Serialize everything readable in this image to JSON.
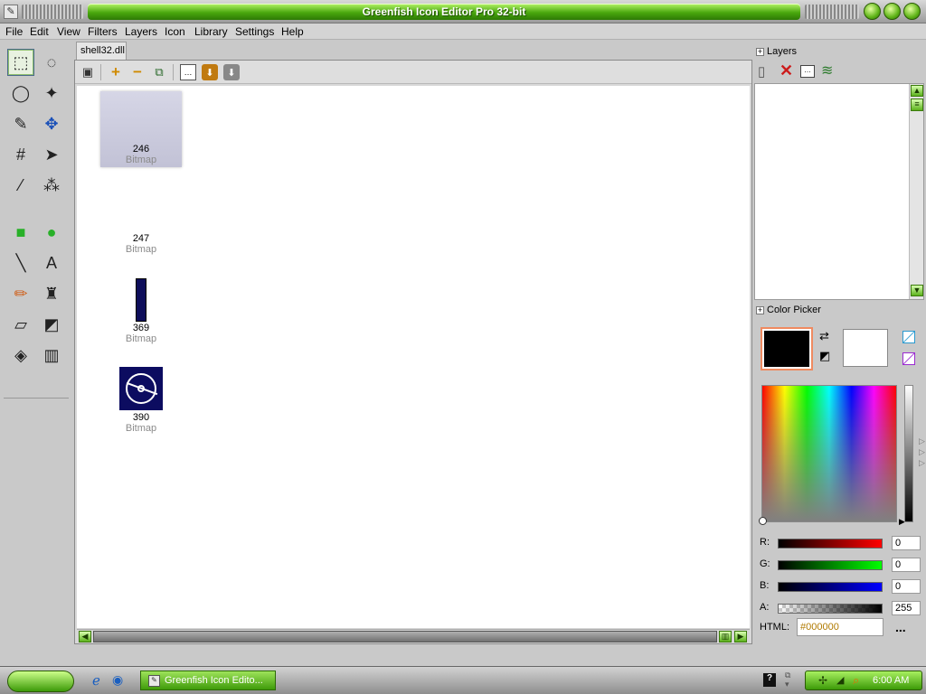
{
  "window": {
    "title": "Greenfish Icon Editor Pro 32-bit",
    "app_icon": "app-icon"
  },
  "menu": [
    "File",
    "Edit",
    "View",
    "Filters",
    "Layers",
    "Icon",
    "Library",
    "Settings",
    "Help"
  ],
  "tools": [
    {
      "name": "rect-select-icon",
      "glyph": "⬚",
      "active": true
    },
    {
      "name": "ellipse-select-icon",
      "glyph": "◌",
      "active": false
    },
    {
      "name": "lasso-icon",
      "glyph": "◯",
      "active": false
    },
    {
      "name": "magic-wand-icon",
      "glyph": "✦",
      "active": false
    },
    {
      "name": "pen-select-icon",
      "glyph": "✎",
      "active": false
    },
    {
      "name": "move-icon",
      "glyph": "✥",
      "active": false
    },
    {
      "name": "crop-icon",
      "glyph": "#",
      "active": false
    },
    {
      "name": "pointer-icon",
      "glyph": "➤",
      "active": false
    },
    {
      "name": "eyedropper-icon",
      "glyph": "⁄",
      "active": false
    },
    {
      "name": "spray-icon",
      "glyph": "⁂",
      "active": false
    },
    {
      "name": "rectangle-icon",
      "glyph": "■",
      "active": false
    },
    {
      "name": "ellipse-icon",
      "glyph": "●",
      "active": false
    },
    {
      "name": "line-icon",
      "glyph": "╲",
      "active": false
    },
    {
      "name": "text-icon",
      "glyph": "A",
      "active": false
    },
    {
      "name": "pencil-icon",
      "glyph": "✏",
      "active": false
    },
    {
      "name": "brush-icon",
      "glyph": "♜",
      "active": false
    },
    {
      "name": "eraser-icon",
      "glyph": "▱",
      "active": false
    },
    {
      "name": "color-swap-icon",
      "glyph": "◩",
      "active": false
    },
    {
      "name": "fill-icon",
      "glyph": "◈",
      "active": false
    },
    {
      "name": "gradient-icon",
      "glyph": "▥",
      "active": false
    }
  ],
  "document": {
    "tab_label": "shell32.dll"
  },
  "icons": [
    {
      "number": "246",
      "kind": "Bitmap",
      "selected": true,
      "thumb": "blank"
    },
    {
      "number": "247",
      "kind": "Bitmap",
      "selected": false,
      "thumb": "blank"
    },
    {
      "number": "369",
      "kind": "Bitmap",
      "selected": false,
      "thumb": "bar"
    },
    {
      "number": "390",
      "kind": "Bitmap",
      "selected": false,
      "thumb": "disc"
    }
  ],
  "layers_panel": {
    "title": "Layers"
  },
  "color_picker": {
    "title": "Color Picker",
    "channels": [
      {
        "label": "R:",
        "value": "0",
        "color": "#ff0000"
      },
      {
        "label": "G:",
        "value": "0",
        "color": "#00ff00"
      },
      {
        "label": "B:",
        "value": "0",
        "color": "#0000ff"
      },
      {
        "label": "A:",
        "value": "255",
        "color": "#000000"
      }
    ],
    "html_label": "HTML:",
    "html_value": "#000000",
    "more": "...",
    "foreground": "#000000",
    "background": "#ffffff"
  },
  "taskbar": {
    "app_label": "Greenfish Icon Edito...",
    "clock": "6:00 AM"
  },
  "colors": {
    "accent": "#4aa80e",
    "selection": "#f08a60"
  }
}
